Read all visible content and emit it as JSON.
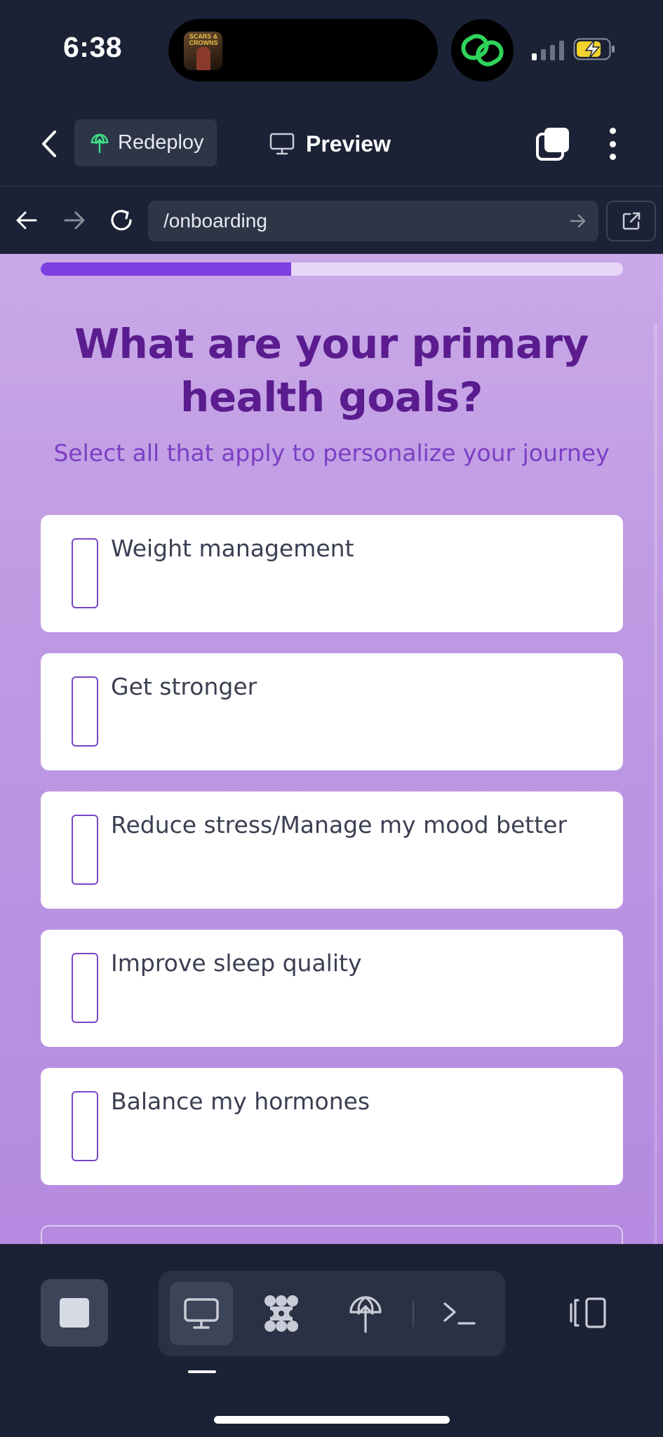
{
  "status_bar": {
    "time": "6:38",
    "album_text": "SCARS & CROWNS",
    "colors": {
      "link_icon": "#2fd35a",
      "battery": "#f2d32b"
    }
  },
  "top_nav": {
    "redeploy_label": "Redeploy",
    "preview_label": "Preview"
  },
  "url_bar": {
    "url": "/onboarding"
  },
  "onboarding": {
    "progress_fraction": 0.43,
    "question": "What are your primary health goals?",
    "subtitle": "Select all that apply to personalize your journey",
    "options": [
      {
        "label": "Weight management",
        "checked": false
      },
      {
        "label": "Get stronger",
        "checked": false
      },
      {
        "label": "Reduce stress/Manage my mood better",
        "checked": false
      },
      {
        "label": "Improve sleep quality",
        "checked": false
      },
      {
        "label": "Balance my hormones",
        "checked": false
      }
    ],
    "colors": {
      "accent": "#7e3fe0",
      "title": "#5a1c8e",
      "subtitle": "#7c3fc4"
    }
  },
  "bottom_toolbar": {
    "active_mode": "desktop-preview",
    "modes": [
      "desktop-preview",
      "agent",
      "deploy",
      "console"
    ]
  }
}
